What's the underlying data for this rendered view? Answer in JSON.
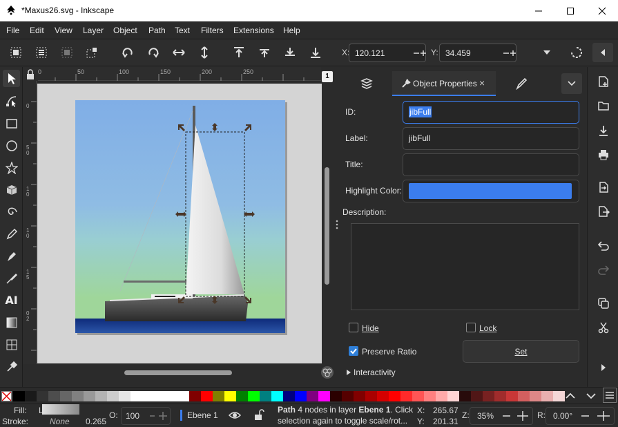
{
  "window": {
    "title": "*Maxus26.svg - Inkscape"
  },
  "menu": [
    "File",
    "Edit",
    "View",
    "Layer",
    "Object",
    "Path",
    "Text",
    "Filters",
    "Extensions",
    "Help"
  ],
  "coords": {
    "x_label": "X:",
    "x_value": "120.121",
    "y_label": "Y:",
    "y_value": "34.459"
  },
  "ruler_top": [
    "0",
    "50",
    "100",
    "150",
    "200",
    "250"
  ],
  "ruler_left": [
    "0",
    "5",
    "0",
    "1",
    "0",
    "1",
    "0",
    "1",
    "5",
    "0",
    "2",
    "0",
    "0",
    "2",
    "5",
    "0",
    "3"
  ],
  "page_badge": "1",
  "dock": {
    "tab_label": "Object Properties"
  },
  "props": {
    "id_label": "ID:",
    "id_value": "jibFull",
    "label_label": "Label:",
    "label_value": "jibFull",
    "title_label": "Title:",
    "title_value": "",
    "highlight_label": "Highlight Color:",
    "highlight_color": "#3b7ded",
    "description_label": "Description:",
    "hide_label": "Hide",
    "lock_label": "Lock",
    "preserve_label": "Preserve Ratio",
    "set_label": "Set",
    "interactivity_label": "Interactivity"
  },
  "status": {
    "fill_label": "Fill:",
    "fill_value": "L",
    "stroke_label": "Stroke:",
    "stroke_value": "None",
    "stroke_width": "0.265",
    "opacity_label": "O:",
    "opacity_value": "100",
    "layer": "Ebene 1",
    "message_bold": "Path",
    "message_1": " 4 nodes in layer ",
    "message_layer": "Ebene 1",
    "message_2": ". Click",
    "message_line2": "selection again to toggle scale/rot...",
    "x_label": "X:",
    "x_value": "265.67",
    "y_label": "Y:",
    "y_value": "201.31",
    "zoom_label": "Z:",
    "zoom_value": "35%",
    "rot_label": "R:",
    "rot_value": "0.00°"
  },
  "palette": [
    "#000000",
    "#1a1a1a",
    "#333333",
    "#4d4d4d",
    "#666666",
    "#808080",
    "#999999",
    "#b3b3b3",
    "#cccccc",
    "#e6e6e6",
    "#ffffff",
    "#ffffff",
    "#ffffff",
    "#ffffff",
    "#ffffff",
    "#800000",
    "#ff0000",
    "#808000",
    "#ffff00",
    "#008000",
    "#00ff00",
    "#008080",
    "#00ffff",
    "#000080",
    "#0000ff",
    "#800080",
    "#ff00ff",
    "#2b0000",
    "#550000",
    "#800000",
    "#aa0000",
    "#d40000",
    "#ff0000",
    "#ff2a2a",
    "#ff5555",
    "#ff8080",
    "#ffaaaa",
    "#ffd5d5",
    "#280b0b",
    "#501616",
    "#782121",
    "#a02c2c",
    "#c83737",
    "#d35f5f",
    "#de8787",
    "#e9afaf",
    "#f4d7d7"
  ],
  "colors": {
    "accent": "#3b7ded",
    "sky_top": "#80aee6",
    "sky_bottom": "#9fd69a",
    "water": "#1a3d8a"
  }
}
